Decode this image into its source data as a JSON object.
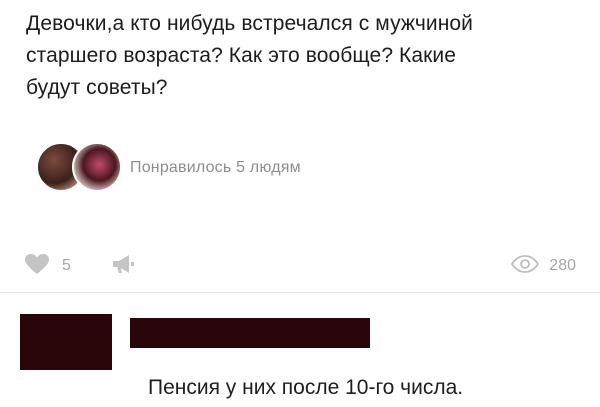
{
  "post": {
    "lines": [
      "Девочки,а кто нибудь встречался с мужчиной",
      "старшего возраста? Как это вообще? Какие",
      "будут советы?"
    ]
  },
  "likes": {
    "summary": "Понравилось 5 людям"
  },
  "actions": {
    "like_count": "5",
    "views_count": "280"
  },
  "comment": {
    "text": "Пенсия у них после 10-го числа."
  },
  "colors": {
    "redaction": "#2a0509",
    "muted_text": "#8d8d8d",
    "icon": "#a6a6a6"
  },
  "icons": {
    "like": "heart-icon",
    "share": "megaphone-icon",
    "views": "eye-icon"
  }
}
